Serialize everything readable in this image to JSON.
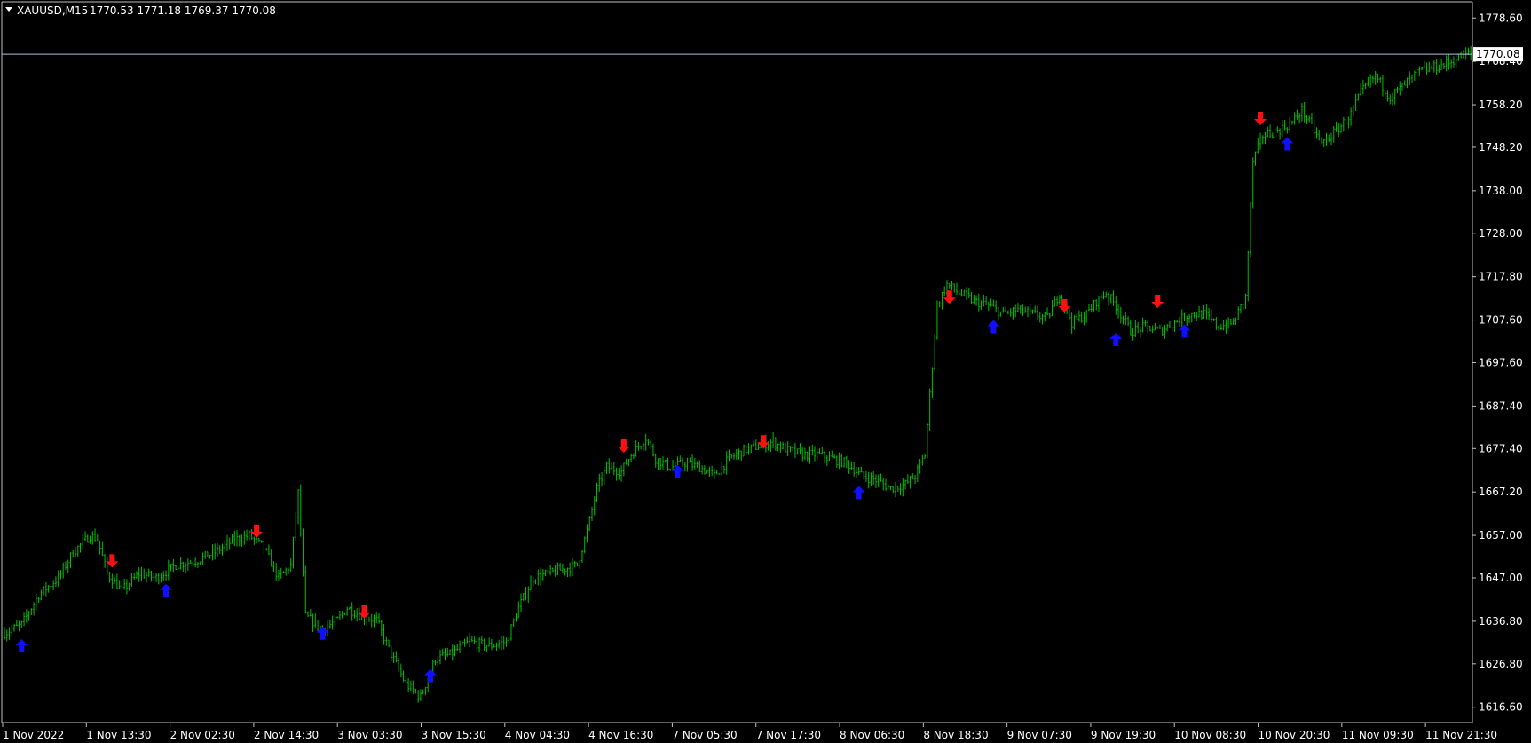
{
  "header": {
    "menu_arrow": "triangle-down-icon",
    "symbol": "XAUUSD,M15",
    "ohlc": "1770.53 1771.18 1769.37 1770.08"
  },
  "chart_data": {
    "type": "ohlc",
    "symbol": "XAUUSD",
    "timeframe": "M15",
    "ylim": [
      1613.2,
      1782.2
    ],
    "y_ticks": [
      "1778.60",
      "1768.40",
      "1758.20",
      "1748.20",
      "1738.00",
      "1728.00",
      "1717.80",
      "1707.60",
      "1697.60",
      "1687.40",
      "1677.40",
      "1667.20",
      "1657.00",
      "1647.00",
      "1636.80",
      "1626.80",
      "1616.60"
    ],
    "x_ticks": [
      "1 Nov 2022",
      "1 Nov 13:30",
      "2 Nov 02:30",
      "2 Nov 14:30",
      "3 Nov 03:30",
      "3 Nov 15:30",
      "4 Nov 04:30",
      "4 Nov 16:30",
      "7 Nov 05:30",
      "7 Nov 17:30",
      "8 Nov 06:30",
      "8 Nov 18:30",
      "9 Nov 07:30",
      "9 Nov 19:30",
      "10 Nov 08:30",
      "10 Nov 20:30",
      "11 Nov 09:30",
      "11 Nov 21:30"
    ],
    "current_price": "1770.08",
    "price_path": [
      [
        0,
        1634
      ],
      [
        7,
        1636
      ],
      [
        14,
        1643
      ],
      [
        22,
        1647
      ],
      [
        28,
        1653
      ],
      [
        35,
        1657
      ],
      [
        38,
        1656
      ],
      [
        42,
        1648
      ],
      [
        48,
        1644
      ],
      [
        55,
        1648
      ],
      [
        62,
        1647
      ],
      [
        70,
        1650
      ],
      [
        78,
        1651
      ],
      [
        86,
        1653
      ],
      [
        94,
        1656
      ],
      [
        100,
        1657
      ],
      [
        106,
        1654
      ],
      [
        112,
        1647
      ],
      [
        117,
        1650
      ],
      [
        120,
        1667
      ],
      [
        123,
        1638
      ],
      [
        130,
        1635
      ],
      [
        136,
        1637
      ],
      [
        140,
        1640
      ],
      [
        146,
        1638
      ],
      [
        152,
        1637
      ],
      [
        158,
        1629
      ],
      [
        164,
        1622
      ],
      [
        170,
        1619
      ],
      [
        176,
        1628
      ],
      [
        182,
        1629
      ],
      [
        190,
        1632
      ],
      [
        198,
        1631
      ],
      [
        205,
        1632
      ],
      [
        210,
        1640
      ],
      [
        216,
        1647
      ],
      [
        222,
        1648
      ],
      [
        228,
        1649
      ],
      [
        234,
        1650
      ],
      [
        238,
        1658
      ],
      [
        242,
        1668
      ],
      [
        246,
        1673
      ],
      [
        252,
        1672
      ],
      [
        256,
        1676
      ],
      [
        262,
        1680
      ],
      [
        266,
        1675
      ],
      [
        272,
        1673
      ],
      [
        278,
        1674
      ],
      [
        284,
        1673
      ],
      [
        290,
        1671
      ],
      [
        296,
        1675
      ],
      [
        302,
        1677
      ],
      [
        308,
        1678
      ],
      [
        314,
        1679
      ],
      [
        320,
        1677
      ],
      [
        326,
        1676
      ],
      [
        332,
        1676
      ],
      [
        338,
        1675
      ],
      [
        344,
        1674
      ],
      [
        350,
        1671
      ],
      [
        356,
        1670
      ],
      [
        362,
        1668
      ],
      [
        368,
        1669
      ],
      [
        372,
        1671
      ],
      [
        376,
        1676
      ],
      [
        378,
        1690
      ],
      [
        381,
        1711
      ],
      [
        385,
        1716
      ],
      [
        390,
        1714
      ],
      [
        396,
        1712
      ],
      [
        402,
        1711
      ],
      [
        408,
        1709
      ],
      [
        414,
        1710
      ],
      [
        420,
        1709
      ],
      [
        426,
        1708
      ],
      [
        431,
        1714
      ],
      [
        436,
        1707
      ],
      [
        442,
        1709
      ],
      [
        446,
        1712
      ],
      [
        450,
        1714
      ],
      [
        454,
        1711
      ],
      [
        460,
        1705
      ],
      [
        466,
        1706
      ],
      [
        472,
        1705
      ],
      [
        478,
        1707
      ],
      [
        484,
        1709
      ],
      [
        490,
        1709
      ],
      [
        496,
        1706
      ],
      [
        502,
        1707
      ],
      [
        507,
        1713
      ],
      [
        510,
        1745
      ],
      [
        514,
        1751
      ],
      [
        520,
        1752
      ],
      [
        526,
        1754
      ],
      [
        530,
        1757
      ],
      [
        534,
        1753
      ],
      [
        538,
        1749
      ],
      [
        544,
        1752
      ],
      [
        550,
        1756
      ],
      [
        554,
        1761
      ],
      [
        560,
        1765
      ],
      [
        566,
        1760
      ],
      [
        572,
        1763
      ],
      [
        578,
        1766
      ],
      [
        584,
        1767
      ],
      [
        590,
        1768
      ],
      [
        596,
        1770
      ]
    ],
    "signals": [
      {
        "type": "up",
        "bar": 7,
        "price": 1633
      },
      {
        "type": "down",
        "bar": 44,
        "price": 1649
      },
      {
        "type": "up",
        "bar": 66,
        "price": 1646
      },
      {
        "type": "down",
        "bar": 103,
        "price": 1656
      },
      {
        "type": "up",
        "bar": 130,
        "price": 1636
      },
      {
        "type": "down",
        "bar": 147,
        "price": 1637
      },
      {
        "type": "up",
        "bar": 174,
        "price": 1626
      },
      {
        "type": "down",
        "bar": 253,
        "price": 1676
      },
      {
        "type": "up",
        "bar": 275,
        "price": 1674
      },
      {
        "type": "down",
        "bar": 310,
        "price": 1677
      },
      {
        "type": "up",
        "bar": 349,
        "price": 1669
      },
      {
        "type": "down",
        "bar": 386,
        "price": 1711
      },
      {
        "type": "up",
        "bar": 404,
        "price": 1708
      },
      {
        "type": "down",
        "bar": 433,
        "price": 1709
      },
      {
        "type": "up",
        "bar": 454,
        "price": 1705
      },
      {
        "type": "down",
        "bar": 471,
        "price": 1710
      },
      {
        "type": "up",
        "bar": 482,
        "price": 1707
      },
      {
        "type": "down",
        "bar": 513,
        "price": 1753
      },
      {
        "type": "up",
        "bar": 524,
        "price": 1751
      }
    ],
    "colors": {
      "background": "#000000",
      "bars": "#00c000",
      "up_arrow": "#1010ff",
      "down_arrow": "#ff1010",
      "axis": "#c0c0c0",
      "text": "#ffffff",
      "price_line": "#b0c4de"
    }
  }
}
